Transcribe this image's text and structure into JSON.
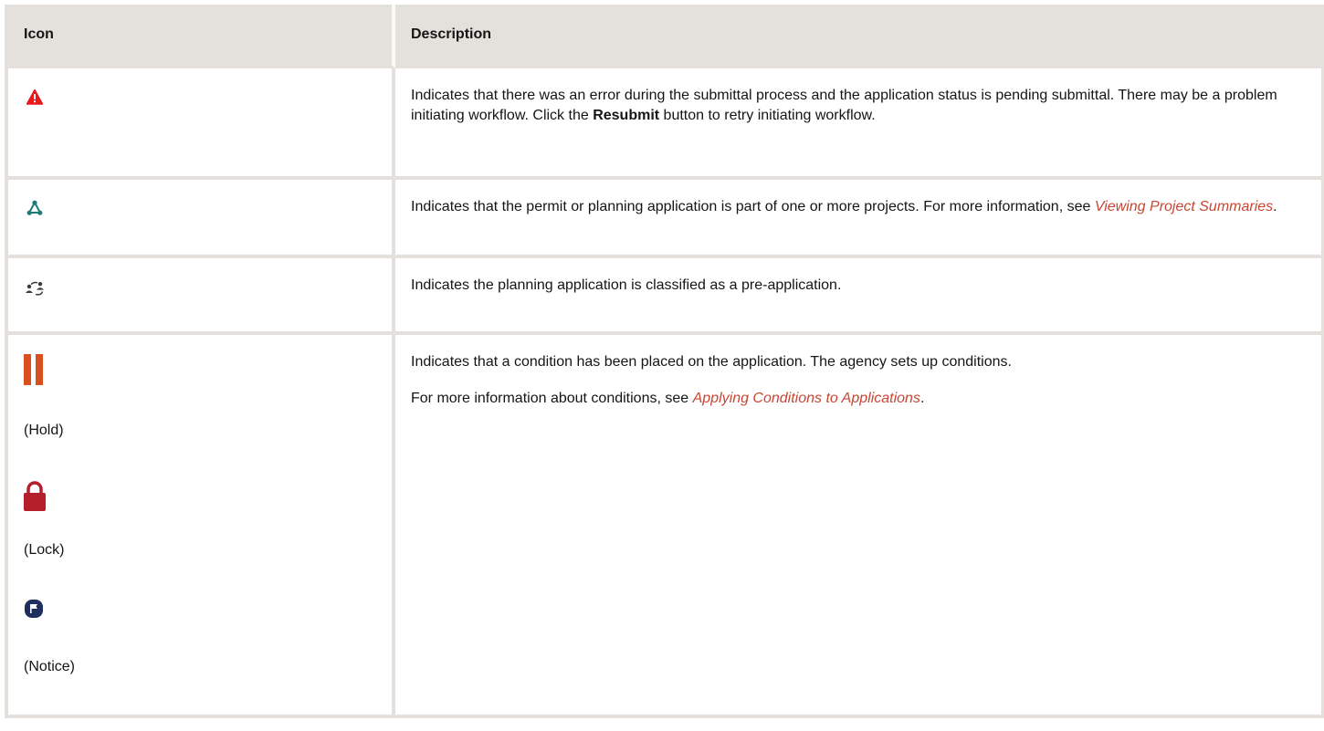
{
  "table": {
    "header": {
      "icon": "Icon",
      "description": "Description"
    },
    "rows": [
      {
        "icon_name": "warning-icon",
        "icon_color": "#e8181b",
        "desc_before": "Indicates that there was an error during the submittal process and the application status is pending submittal. There may be a problem initiating workflow. Click the ",
        "desc_bold": "Resubmit",
        "desc_after": " button to retry initiating workflow."
      },
      {
        "icon_name": "project-icon",
        "icon_color": "#1e7a7a",
        "desc_before": "Indicates that the permit or planning application is part of one or more projects. For more information, see ",
        "desc_link": "Viewing Project Summaries",
        "desc_after": "."
      },
      {
        "icon_name": "pre-application-icon",
        "icon_color": "#3a3a3a",
        "desc": "Indicates the planning application is classified as a pre-application."
      },
      {
        "icons": [
          {
            "name": "hold-icon",
            "color": "#d9501f",
            "caption": "(Hold)"
          },
          {
            "name": "lock-icon",
            "color": "#b51e2b",
            "caption": "(Lock)"
          },
          {
            "name": "notice-icon",
            "color": "#1e2f5e",
            "caption": "(Notice)"
          }
        ],
        "desc_p1": "Indicates that a condition has been placed on the application. The agency sets up conditions.",
        "desc_p2_before": "For more information about conditions, see ",
        "desc_p2_link": "Applying Conditions to Applications",
        "desc_p2_after": "."
      }
    ]
  }
}
